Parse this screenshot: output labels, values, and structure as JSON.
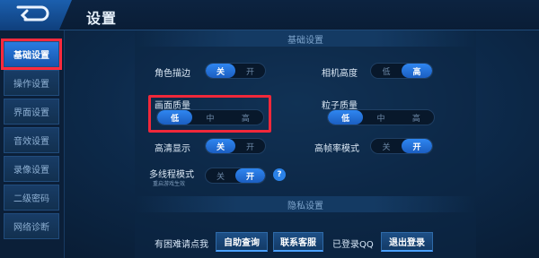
{
  "header": {
    "title": "设置",
    "back_icon": "back-arrow-icon"
  },
  "sidebar": {
    "items": [
      {
        "label": "基础设置",
        "active": true
      },
      {
        "label": "操作设置",
        "active": false
      },
      {
        "label": "界面设置",
        "active": false
      },
      {
        "label": "音效设置",
        "active": false
      },
      {
        "label": "录像设置",
        "active": false
      },
      {
        "label": "二级密码",
        "active": false
      },
      {
        "label": "网络诊断",
        "active": false
      }
    ]
  },
  "basic": {
    "heading": "基础设置",
    "role_outline": {
      "label": "角色描边",
      "options": [
        "关",
        "开"
      ],
      "selected": "关"
    },
    "camera_height": {
      "label": "相机高度",
      "options": [
        "低",
        "高"
      ],
      "selected": "高"
    },
    "graphics_quality": {
      "label": "画面质量",
      "options": [
        "低",
        "中",
        "高"
      ],
      "selected": "低"
    },
    "particle_quality": {
      "label": "粒子质量",
      "options": [
        "低",
        "中",
        "高"
      ],
      "selected": "低"
    },
    "hd_display": {
      "label": "高清显示",
      "options": [
        "关",
        "开"
      ],
      "selected": "关"
    },
    "high_fps": {
      "label": "高帧率模式",
      "options": [
        "关",
        "开"
      ],
      "selected": "开"
    },
    "multithread": {
      "label": "多线程模式",
      "sublabel": "重启游戏生效",
      "options": [
        "关",
        "开"
      ],
      "selected": "开",
      "help": "?"
    }
  },
  "privacy": {
    "heading": "隐私设置"
  },
  "footer": {
    "help_text": "有困难请点我",
    "self_help_button": "自助查询",
    "contact_button": "联系客服",
    "qq_status": "已登录QQ",
    "logout_button": "退出登录"
  },
  "colors": {
    "accent": "#2f86f0",
    "highlight": "#f0283a",
    "background": "#0d2a4b"
  }
}
